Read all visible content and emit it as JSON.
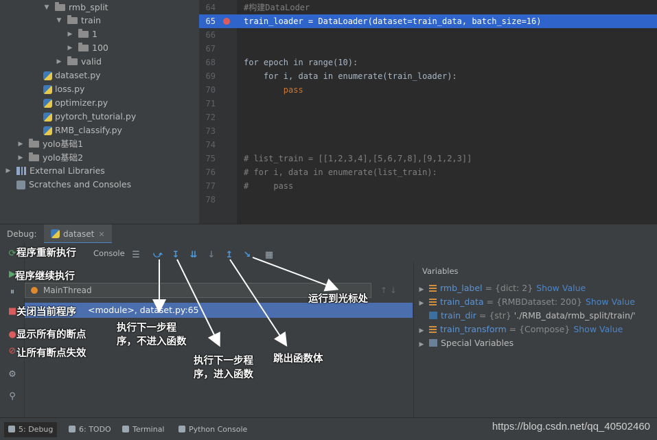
{
  "project_tree": [
    {
      "label": "rmb_split",
      "kind": "folder",
      "expanded": true
    },
    {
      "label": "train",
      "kind": "folder",
      "expanded": true
    },
    {
      "label": "1",
      "kind": "folder",
      "expanded": false
    },
    {
      "label": "100",
      "kind": "folder",
      "expanded": false
    },
    {
      "label": "valid",
      "kind": "folder",
      "expanded": false
    },
    {
      "label": "dataset.py",
      "kind": "python-file"
    },
    {
      "label": "loss.py",
      "kind": "python-file"
    },
    {
      "label": "optimizer.py",
      "kind": "python-file"
    },
    {
      "label": "pytorch_tutorial.py",
      "kind": "python-file"
    },
    {
      "label": "RMB_classify.py",
      "kind": "python-file"
    },
    {
      "label": "yolo基础1",
      "kind": "folder",
      "expanded": false
    },
    {
      "label": "yolo基础2",
      "kind": "folder",
      "expanded": false
    },
    {
      "label": "External Libraries",
      "kind": "libraries",
      "expanded": false
    },
    {
      "label": "Scratches and Consoles",
      "kind": "scratches"
    }
  ],
  "editor": {
    "lines": [
      {
        "num": "64",
        "text": "#构建DataLoder"
      },
      {
        "num": "65",
        "text": "train_loader = DataLoader(dataset=train_data, batch_size=16)",
        "current": true,
        "breakpoint": true
      },
      {
        "num": "66",
        "text": ""
      },
      {
        "num": "67",
        "text": ""
      },
      {
        "num": "68",
        "text": "for epoch in range(10):"
      },
      {
        "num": "69",
        "text": "    for i, data in enumerate(train_loader):"
      },
      {
        "num": "70",
        "text": "        pass"
      },
      {
        "num": "71",
        "text": ""
      },
      {
        "num": "72",
        "text": ""
      },
      {
        "num": "73",
        "text": ""
      },
      {
        "num": "74",
        "text": ""
      },
      {
        "num": "75",
        "text": "# list_train = [[1,2,3,4],[5,6,7,8],[9,1,2,3]]"
      },
      {
        "num": "76",
        "text": "# for i, data in enumerate(list_train):"
      },
      {
        "num": "77",
        "text": "#     pass"
      },
      {
        "num": "78",
        "text": ""
      }
    ]
  },
  "debug": {
    "label": "Debug:",
    "tab": "dataset",
    "console_tab": "Console",
    "thread": "MainThread",
    "frame": "<module>, dataset.py:65",
    "variables_title": "Variables",
    "show_value": "Show Value",
    "variables": [
      {
        "name": "rmb_label",
        "value": "= {dict: 2}",
        "show": true,
        "expandable": true,
        "icon": "field-icon"
      },
      {
        "name": "train_data",
        "value": "= {RMBDataset: 200}",
        "show": true,
        "expandable": true,
        "icon": "field-icon"
      },
      {
        "name": "train_dir",
        "value": "= {str}",
        "str": "'./RMB_data/rmb_split/train/'",
        "show": false,
        "expandable": false,
        "icon": "str-icon"
      },
      {
        "name": "train_transform",
        "value": "= {Compose}",
        "show": true,
        "expandable": true,
        "icon": "field-icon"
      },
      {
        "name": "Special Variables",
        "value": "",
        "show": false,
        "expandable": true,
        "icon": "special-icon"
      }
    ]
  },
  "statusbar": {
    "tabs": [
      {
        "label": "5: Debug",
        "active": true
      },
      {
        "label": "6: TODO"
      },
      {
        "label": "Terminal"
      },
      {
        "label": "Python Console"
      }
    ],
    "watermark": "https://blog.csdn.net/qq_40502460"
  },
  "annotations": {
    "rerun": "程序重新执行",
    "resume": "程序继续执行",
    "stop": "关闭当前程序",
    "view_breakpoints": "显示所有的断点",
    "mute_breakpoints": "让所有断点失效",
    "step_over": [
      "执行下一步程",
      "序，不进入函数"
    ],
    "step_into": [
      "执行下一步程",
      "序，进入函数"
    ],
    "step_out": "跳出函数体",
    "run_to_cursor": "运行到光标处"
  },
  "colors": {
    "current_line": "#2f65ca",
    "breakpoint": "#db5c5c",
    "selected_frame": "#4b6eaf",
    "link": "#4b86c8"
  }
}
